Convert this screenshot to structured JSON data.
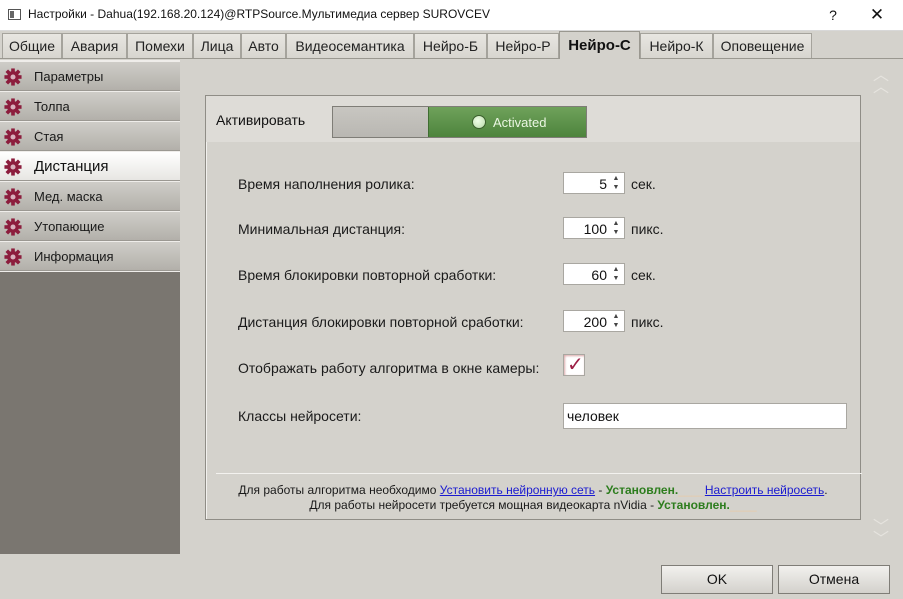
{
  "window": {
    "title": "Настройки - Dahua(192.168.20.124)@RTPSource.Мультимедиа сервер SUROVCEV",
    "help_label": "?",
    "close_label": "✕"
  },
  "tabs": [
    {
      "label": "Общие"
    },
    {
      "label": "Авария"
    },
    {
      "label": "Помехи"
    },
    {
      "label": "Лица"
    },
    {
      "label": "Авто"
    },
    {
      "label": "Видеосемантика"
    },
    {
      "label": "Нейро-Б"
    },
    {
      "label": "Нейро-Р"
    },
    {
      "label": "Нейро-С"
    },
    {
      "label": "Нейро-К"
    },
    {
      "label": "Оповещение"
    }
  ],
  "active_tab": "Нейро-С",
  "sidebar": {
    "items": [
      {
        "label": "Параметры"
      },
      {
        "label": "Толпа"
      },
      {
        "label": "Стая"
      },
      {
        "label": "Дистанция"
      },
      {
        "label": "Мед. маска"
      },
      {
        "label": "Утопающие"
      },
      {
        "label": "Информация"
      }
    ],
    "active": "Дистанция"
  },
  "main": {
    "activate_label": "Активировать",
    "toggle_state": "Activated",
    "fields": [
      {
        "label": "Время наполнения ролика:",
        "value": "5",
        "unit": "сек."
      },
      {
        "label": "Минимальная дистанция:",
        "value": "100",
        "unit": "пикс."
      },
      {
        "label": "Время блокировки повторной сработки:",
        "value": "60",
        "unit": "сек."
      },
      {
        "label": "Дистанция блокировки повторной сработки:",
        "value": "200",
        "unit": "пикс."
      }
    ],
    "show_algorithm_label": "Отображать работу алгоритма в окне камеры:",
    "show_algorithm_checked": true,
    "classes_label": "Классы нейросети:",
    "classes_value": "человек"
  },
  "footer_note": {
    "line1_prefix": "Для работы алгоритма необходимо",
    "line1_link1": "Установить нейронную сеть",
    "line1_dash": " - ",
    "line1_status": "Установлен.",
    "line1_sep": "____",
    "line1_link2": "Настроить нейросеть",
    "line1_end": ".",
    "line2_prefix": "Для работы нейросети требуется мощная видеокарта nVidia",
    "line2_dash": " - ",
    "line2_status": "Установлен.",
    "line2_sep": "____"
  },
  "buttons": {
    "ok": "OK",
    "cancel": "Отмена"
  },
  "colors": {
    "toggle_on": "#5a9047",
    "link": "#1a1ad0",
    "status_ok": "#2d7d1e",
    "checkmark": "#9c1e45",
    "sidebar_dark": "#7a7670"
  }
}
